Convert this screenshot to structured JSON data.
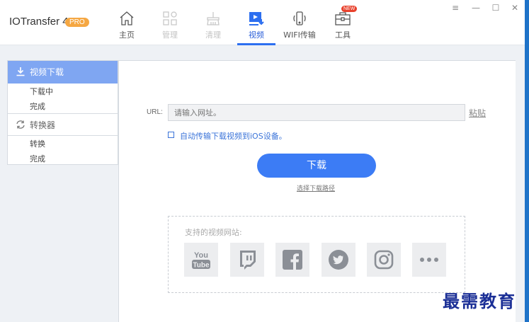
{
  "app": {
    "title": "IOTransfer 4",
    "badge": "PRO"
  },
  "nav": {
    "items": [
      {
        "label": "主页",
        "icon": "home-icon"
      },
      {
        "label": "管理",
        "icon": "manage-icon"
      },
      {
        "label": "清理",
        "icon": "clean-icon"
      },
      {
        "label": "视频",
        "icon": "video-download-icon"
      },
      {
        "label": "WIFI传输",
        "icon": "wifi-transfer-icon"
      },
      {
        "label": "工具",
        "icon": "toolbox-icon",
        "badge": "NEW"
      }
    ],
    "active": "视频"
  },
  "window_controls": [
    "≡",
    "—",
    "☐",
    "✕"
  ],
  "sidebar": {
    "video_download": {
      "label": "视频下载",
      "icon": "download-icon",
      "items": [
        "下载中",
        "完成"
      ]
    },
    "converter": {
      "label": "转换器",
      "icon": "convert-icon",
      "items": [
        "转换",
        "完成"
      ]
    }
  },
  "main": {
    "url_label": "URL:",
    "url_placeholder": "请输入网址。",
    "paste_label": "粘贴",
    "auto_transfer_label": "自动传输下载视频到iOS设备。",
    "auto_transfer_checked": false,
    "download_button": "下载",
    "choose_path_label": "选择下载路径",
    "supported_sites_title": "支持的视频网站:",
    "sites": [
      "youtube-icon",
      "twitch-icon",
      "facebook-icon",
      "twitter-icon",
      "instagram-icon",
      "more-icon"
    ],
    "youtube_logo_text": [
      "You",
      "Tube"
    ]
  },
  "watermark": "最需教育",
  "colors": {
    "accent": "#3c7cf5",
    "sidebar_active": "#7fa6f2",
    "pro_badge": "#f5a742",
    "new_badge": "#e8412c",
    "watermark": "#1b2f96"
  }
}
